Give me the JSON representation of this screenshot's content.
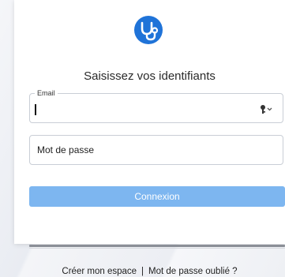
{
  "form": {
    "title": "Saisissez vos identifiants",
    "email_label": "Email",
    "email_value": "",
    "password_placeholder": "Mot de passe",
    "submit_label": "Connexion"
  },
  "footer": {
    "create_account": "Créer mon espace",
    "separator": "|",
    "forgot_password": "Mot de passe oublié ?"
  },
  "icons": {
    "logo": "stethoscope-icon",
    "password_manager": "key-icon"
  },
  "colors": {
    "brand": "#1f73d8",
    "button": "#7db6f0"
  }
}
